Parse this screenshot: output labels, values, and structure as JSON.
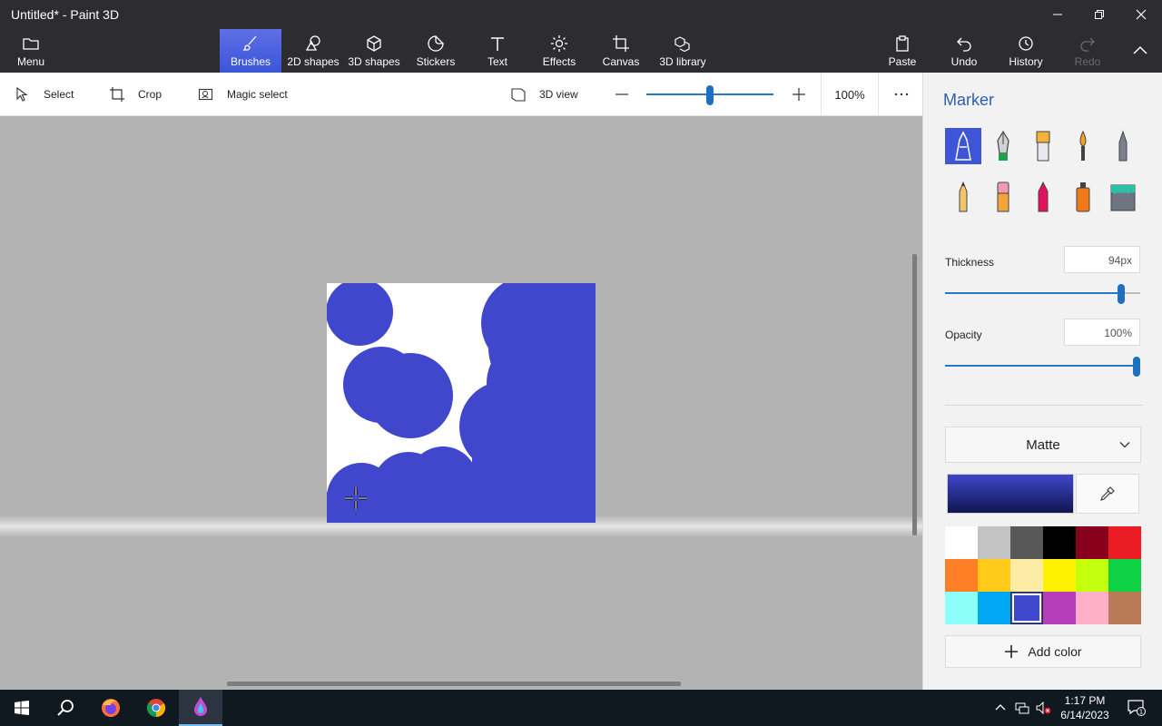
{
  "window": {
    "title": "Untitled* - Paint 3D"
  },
  "ribbon": {
    "menu": "Menu",
    "tabs": [
      {
        "label": "Brushes",
        "icon": "brush-icon",
        "active": true
      },
      {
        "label": "2D shapes",
        "icon": "2d-shapes-icon"
      },
      {
        "label": "3D shapes",
        "icon": "3d-shapes-icon"
      },
      {
        "label": "Stickers",
        "icon": "stickers-icon"
      },
      {
        "label": "Text",
        "icon": "text-icon"
      },
      {
        "label": "Effects",
        "icon": "effects-icon"
      },
      {
        "label": "Canvas",
        "icon": "canvas-icon"
      },
      {
        "label": "3D library",
        "icon": "3d-library-icon"
      }
    ],
    "paste": "Paste",
    "undo": "Undo",
    "history": "History",
    "redo": "Redo"
  },
  "toolbar": {
    "select": "Select",
    "crop": "Crop",
    "magic_select": "Magic select",
    "view_3d": "3D view",
    "zoom": "100%",
    "zoom_value": 0.5
  },
  "panel": {
    "title": "Marker",
    "thickness_label": "Thickness",
    "thickness_value": "94px",
    "thickness_fraction": 0.92,
    "opacity_label": "Opacity",
    "opacity_value": "100%",
    "opacity_fraction": 1.0,
    "material": "Matte",
    "add_color": "Add color",
    "current_color": "#3e48c9",
    "palette": [
      "#ffffff",
      "#c3c3c3",
      "#585858",
      "#000000",
      "#88001b",
      "#ec1c24",
      "#ff7f27",
      "#ffca18",
      "#fdeca6",
      "#fff200",
      "#c4ff0e",
      "#0ed145",
      "#8cfffb",
      "#00a8f3",
      "#3f48cc",
      "#b83dba",
      "#ffaec8",
      "#b97a56"
    ],
    "selected_swatch": 14
  },
  "canvas_art": {
    "ink": "#4147cc",
    "paper": "#ffffff"
  },
  "taskbar": {
    "time": "1:17 PM",
    "date": "6/14/2023"
  }
}
